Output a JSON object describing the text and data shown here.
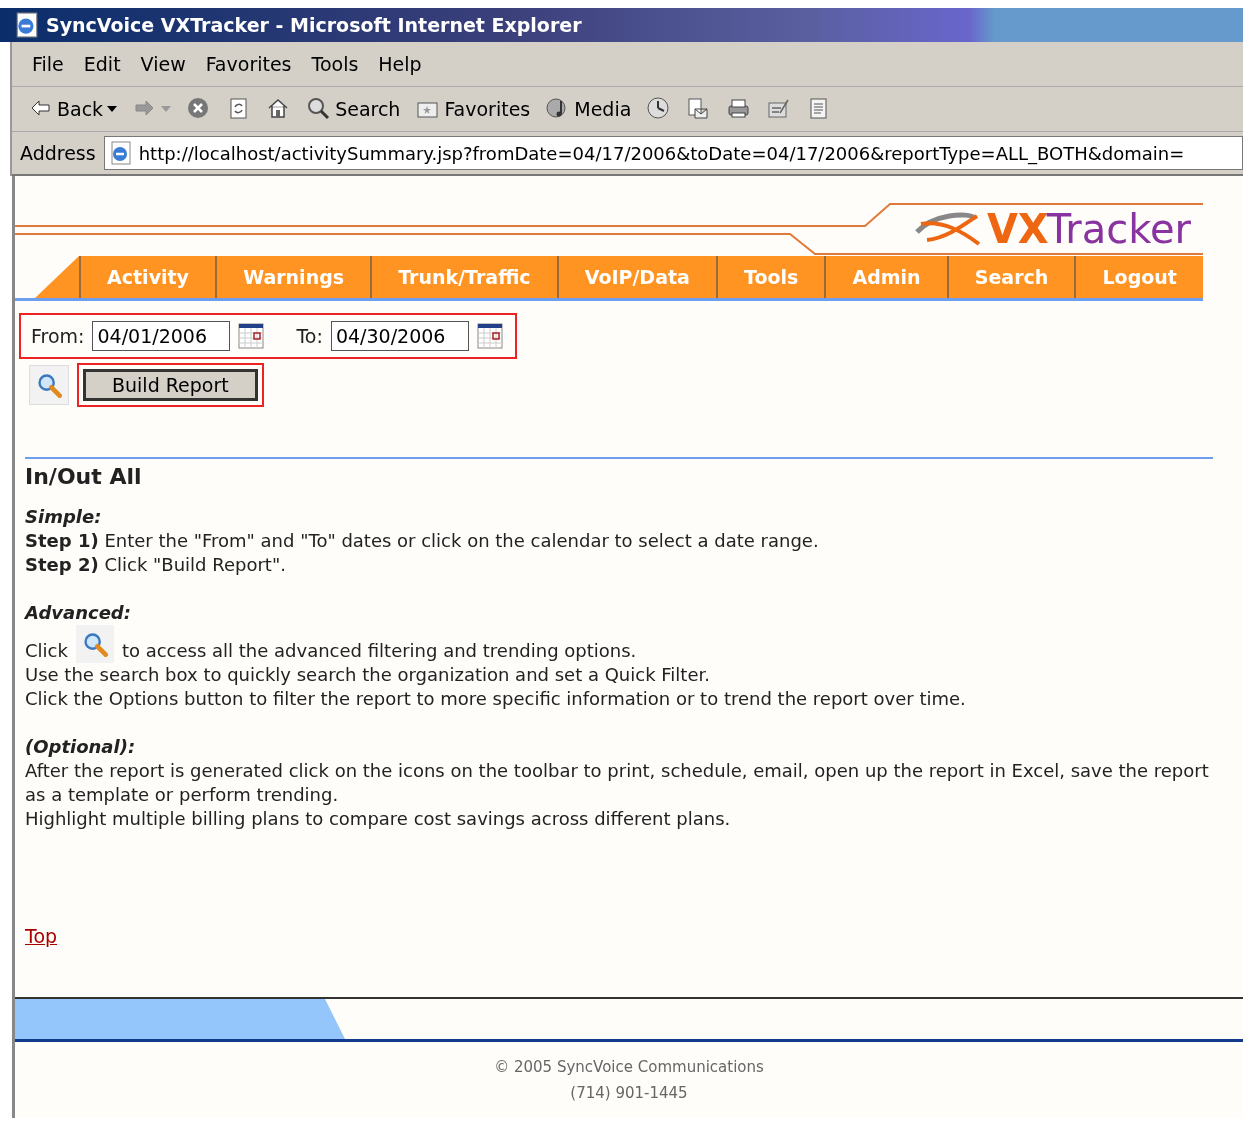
{
  "window": {
    "title": "SyncVoice VXTracker - Microsoft Internet Explorer"
  },
  "menu": [
    "File",
    "Edit",
    "View",
    "Favorites",
    "Tools",
    "Help"
  ],
  "toolbar": [
    {
      "kind": "back",
      "label": "Back"
    },
    {
      "kind": "forward"
    },
    {
      "kind": "stop"
    },
    {
      "kind": "refresh"
    },
    {
      "kind": "home"
    },
    {
      "kind": "search",
      "label": "Search"
    },
    {
      "kind": "favorites",
      "label": "Favorites"
    },
    {
      "kind": "media",
      "label": "Media"
    },
    {
      "kind": "history"
    },
    {
      "kind": "mail"
    },
    {
      "kind": "print"
    },
    {
      "kind": "edit"
    },
    {
      "kind": "discuss"
    }
  ],
  "address": {
    "label": "Address",
    "url": "http://localhost/activitySummary.jsp?fromDate=04/17/2006&toDate=04/17/2006&reportType=ALL_BOTH&domain="
  },
  "logo": {
    "mark": "VX",
    "rest": "Tracker"
  },
  "nav": [
    "Activity",
    "Warnings",
    "Trunk/Traffic",
    "VoIP/Data",
    "Tools",
    "Admin",
    "Search",
    "Logout"
  ],
  "form": {
    "from_label": "From:",
    "from_value": "04/01/2006",
    "to_label": "To:",
    "to_value": "04/30/2006",
    "button": "Build Report"
  },
  "heading": "In/Out All",
  "simple": {
    "title": "Simple:",
    "lines": [
      "**Step 1)** Enter the \"From\" and \"To\" dates or click on the calendar to select a date range.",
      "**Step 2)** Click \"Build Report\"."
    ]
  },
  "advanced": {
    "title": "Advanced:",
    "click_before": "Click",
    "click_after": "to access all the advanced filtering and trending options.",
    "lines": [
      "Use the search box to quickly search the organization and set a Quick Filter.",
      "Click the Options button to filter the report to more specific information or to trend the report over time."
    ]
  },
  "optional": {
    "title": "(Optional):",
    "lines": [
      "After the report is generated click on the icons on the toolbar to print, schedule, email, open up the report in Excel, save the report as a template or perform trending.",
      "Highlight multiple billing plans to compare cost savings across different plans."
    ]
  },
  "top_link": "Top",
  "footer": [
    "© 2005 SyncVoice Communications",
    "(714) 901-1445"
  ]
}
